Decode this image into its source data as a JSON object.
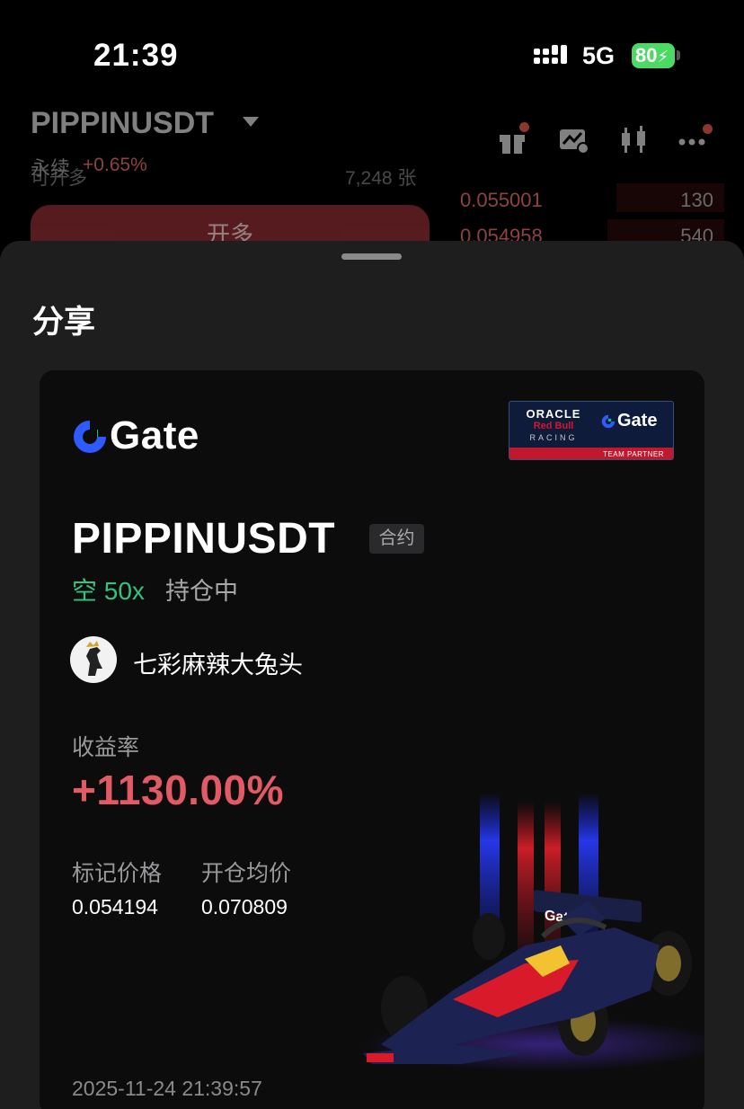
{
  "status_bar": {
    "time": "21:39",
    "network": "5G",
    "battery": "80"
  },
  "background": {
    "pair": "PIPPINUSDT",
    "pair_type": "永续",
    "change": "+0.65%",
    "partial_left": "可开多",
    "partial_qty": "7,248 张",
    "order_book": [
      {
        "price": "0.055001",
        "qty": "130"
      },
      {
        "price": "0.054958",
        "qty": "540"
      }
    ],
    "open_long_label": "开多",
    "icons": [
      "gift-icon",
      "chart-settings-icon",
      "candlestick-icon",
      "more-icon"
    ]
  },
  "sheet": {
    "title": "分享"
  },
  "card": {
    "logo_text": "Gate",
    "partner": {
      "line1": "ORACLE",
      "line2": "Red Bull",
      "line3": "RACING",
      "gate": "Gate",
      "strip": "TEAM PARTNER"
    },
    "symbol": "PIPPINUSDT",
    "tag": "合约",
    "direction": "空 50x",
    "position_status": "持仓中",
    "username": "七彩麻辣大兔头",
    "roi_label": "收益率",
    "roi_value": "+1130.00%",
    "mark_price_label": "标记价格",
    "mark_price": "0.054194",
    "entry_price_label": "开仓均价",
    "entry_price": "0.070809",
    "timestamp": "2025-11-24 21:39:57"
  },
  "colors": {
    "accent_red": "#e25a64",
    "short_green": "#35c17f",
    "battery_green": "#4cd964"
  }
}
